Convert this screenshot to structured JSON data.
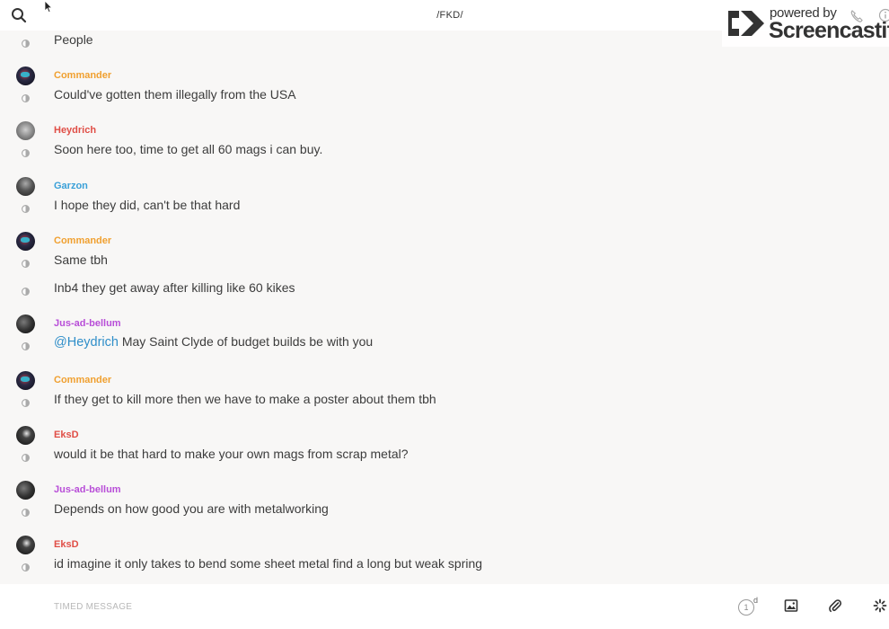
{
  "header": {
    "channel_title": "/FKD/"
  },
  "watermark": {
    "top_text": "powered by",
    "brand": "Screencastify"
  },
  "messages": [
    {
      "author": "",
      "text": "People"
    },
    {
      "author": "Commander",
      "text": "Could've gotten them illegally from the USA"
    },
    {
      "author": "Heydrich",
      "text": "Soon here too, time to get all 60 mags i can buy."
    },
    {
      "author": "Garzon",
      "text": "I hope they did, can't be that hard"
    },
    {
      "author": "Commander",
      "text": "Same tbh"
    },
    {
      "author": "",
      "text": "Inb4 they get away after killing like 60 kikes"
    },
    {
      "author": "Jus-ad-bellum",
      "mention": "@Heydrich",
      "text": " May Saint Clyde of budget builds be with you"
    },
    {
      "author": "Commander",
      "text": "If they get to kill more then we have to make a poster about them tbh"
    },
    {
      "author": "EksD",
      "text": "would it be that hard to make your own mags from scrap metal?"
    },
    {
      "author": "Jus-ad-bellum",
      "text": "Depends on how good you are with metalworking"
    },
    {
      "author": "EksD",
      "text": "id imagine it only takes to bend some sheet metal find a long but weak spring"
    }
  ],
  "author_colors": {
    "Commander": "#f0a030",
    "Heydrich": "#e04e46",
    "Garzon": "#3aa0d8",
    "Jus-ad-bellum": "#b84ed8",
    "EksD": "#e04e46"
  },
  "composer": {
    "placeholder": "TIMED MESSAGE",
    "timer_value": "1",
    "timer_unit": "d"
  },
  "icons": {
    "search": "search-icon",
    "clock": "clock-icon",
    "image": "image-icon",
    "attach": "paperclip-icon",
    "spinner": "spinner-icon"
  }
}
